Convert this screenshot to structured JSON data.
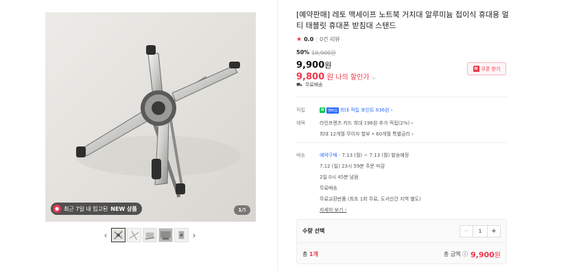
{
  "gallery": {
    "badge_text": "최근 7일 내 입고된",
    "badge_new": "NEW 상품",
    "counter_current": "1",
    "counter_total": "/5",
    "prev_arrow": "‹",
    "next_arrow": "›"
  },
  "product": {
    "title": "[예약판매] 레토 맥세이프 노트북 거치대 알루미늄 접이식 휴대용 멀티 태블릿 휴대폰 받침대 스탠드",
    "rating": "0.0",
    "reviews": "0건 리뷰",
    "discount_pct": "50%",
    "original_price": "10,900원",
    "price": "9,900",
    "price_unit": "원",
    "my_price": "9,800",
    "my_price_unit": "원",
    "my_price_label": "나의 할인가",
    "shipping": "무료배송",
    "coupon_label": "쿠폰 받기",
    "coupon_icon": "N"
  },
  "benefits": {
    "point_label": "적립",
    "point_badge": "N",
    "point_badge2": "멤버십",
    "point_text": "최대 적립 포인트 836원 ›",
    "benefit_label": "혜택",
    "benefit_line1": "라인프렌즈 카드 최대 196원 추가 적립(2%) ›",
    "benefit_line2": "최대 12개월 무이자 할부 • 60개월 특별금리 ›"
  },
  "delivery": {
    "label": "배송",
    "preorder": "예약구매",
    "preorder_rest": " · 7.13 (월) ~ 7.13 (월) 발송예정",
    "line2": "7.12 (일) 23시 59분 주문 마감",
    "line3": "2일 0시 45분 남음",
    "line4": "무료배송",
    "line5": "무료교환반품 (최초 1회 무료, 도서산간 지역 별도)",
    "more": "자세히 보기 ›"
  },
  "buy": {
    "qty_title": "수량 선택",
    "qty": "1",
    "minus": "−",
    "plus": "+",
    "total_prefix": "총 ",
    "total_count": "1개",
    "total_label": "총 금액 ⓘ",
    "total_price": "9,900",
    "total_unit": "원"
  },
  "colors": {
    "accent": "#f0364a",
    "naver_green": "#03c75a",
    "link_blue": "#2e6bff"
  }
}
